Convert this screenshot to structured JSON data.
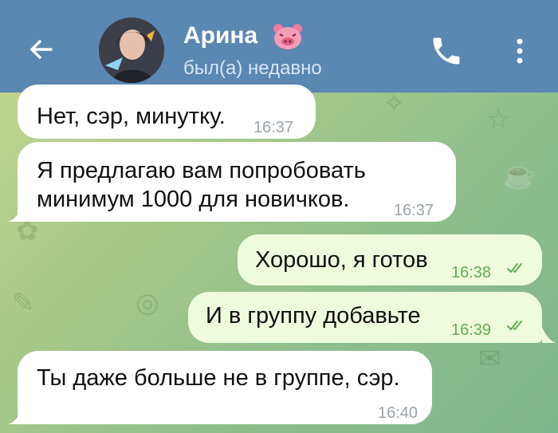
{
  "header": {
    "contact_name": "Арина",
    "status": "был(а) недавно"
  },
  "messages": [
    {
      "text": "Нет, сэр, минутку.",
      "time": "16:37",
      "direction": "incoming"
    },
    {
      "line1": "Я предлагаю вам попробовать",
      "line2": "минимум 1000 для новичков.",
      "time": "16:37",
      "direction": "incoming"
    },
    {
      "text": "Хорошо, я готов",
      "time": "16:38",
      "direction": "outgoing",
      "read": true
    },
    {
      "text": "И в группу добавьте",
      "time": "16:39",
      "direction": "outgoing",
      "read": true
    },
    {
      "text": "Ты даже больше не в группе, сэр.",
      "time": "16:40",
      "direction": "incoming"
    }
  ],
  "icons": {
    "back": "arrow-left-icon",
    "call": "phone-icon",
    "menu": "more-vertical-icon",
    "emoji": "pig-face-emoji-icon",
    "read": "double-check-icon"
  },
  "colors": {
    "header": "#5b87b3",
    "incoming_bubble": "#ffffff",
    "outgoing_bubble": "#effcdc",
    "outgoing_meta": "#62ac55"
  }
}
